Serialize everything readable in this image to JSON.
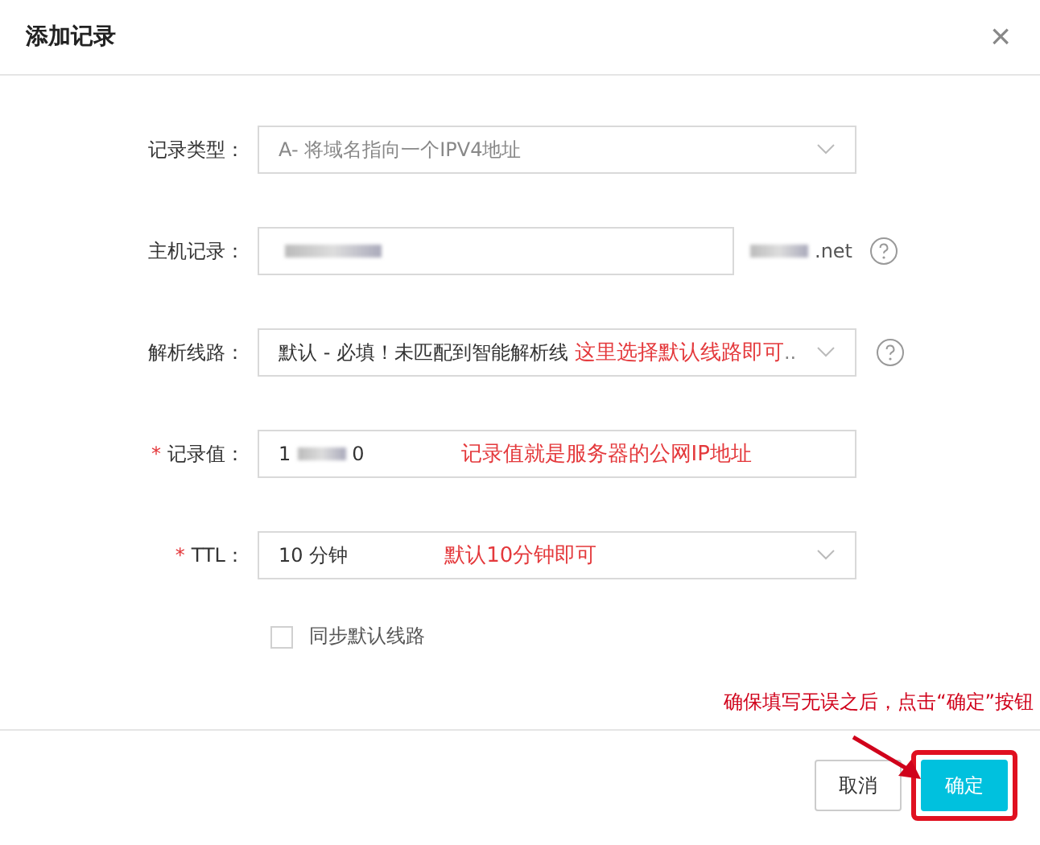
{
  "dialog": {
    "title": "添加记录",
    "close": "×"
  },
  "fields": [
    {
      "kind": "select",
      "label": "记录类型：",
      "value": "A- 将域名指向一个IPV4地址",
      "value_muted": true
    },
    {
      "kind": "input",
      "label": "主机记录：",
      "suffix": ".net",
      "help": true,
      "redacted": true
    },
    {
      "kind": "select",
      "label": "解析线路：",
      "value": "默认 - 必填！未匹配到智能解析线",
      "value_muted": false,
      "note": "这里选择默认线路即可",
      "tail": "..",
      "help": true
    },
    {
      "kind": "input",
      "required_mark": "*",
      "label": "记录值：",
      "value": "1",
      "value_end": "0",
      "note": "记录值就是服务器的公网IP地址",
      "redacted": true
    },
    {
      "kind": "select",
      "required_mark": "*",
      "label": "TTL：",
      "value": "10 分钟",
      "value_muted": false,
      "note": "默认10分钟即可"
    }
  ],
  "sync_checkbox": {
    "label": "同步默认线路",
    "checked": false
  },
  "footer_note": "确保填写无误之后，点击“确定”按钮",
  "buttons": [
    {
      "label": "取消",
      "kind": "secondary"
    },
    {
      "label": "确定",
      "kind": "primary",
      "highlighted": true
    }
  ]
}
